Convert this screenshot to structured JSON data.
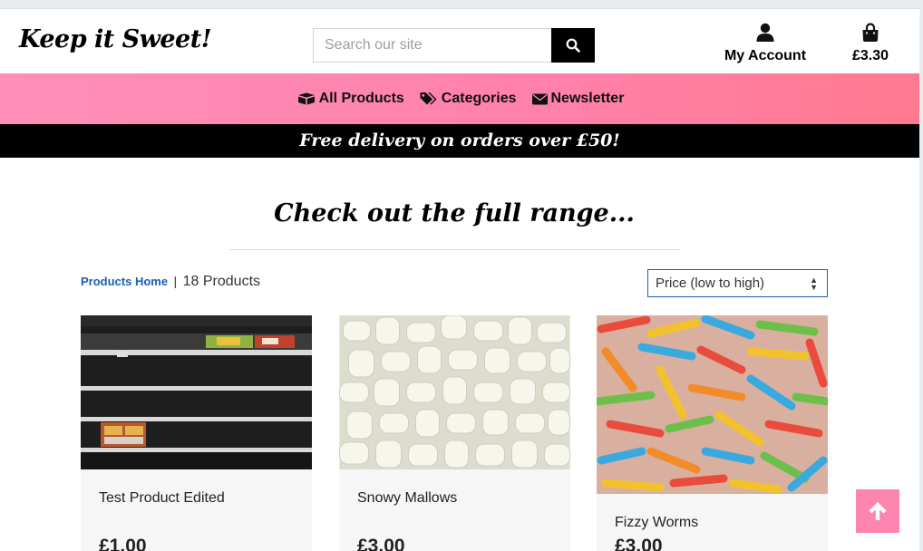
{
  "brand": {
    "logo": "Keep it Sweet!"
  },
  "search": {
    "placeholder": "Search our site",
    "value": ""
  },
  "header": {
    "account_label": "My Account",
    "bag_total": "£3.30"
  },
  "nav": {
    "items": [
      {
        "label": "All Products",
        "icon": "boxes-icon"
      },
      {
        "label": "Categories",
        "icon": "tags-icon"
      },
      {
        "label": "Newsletter",
        "icon": "envelope-icon"
      }
    ]
  },
  "promo": {
    "text": "Free delivery on orders over £50!"
  },
  "page": {
    "title": "Check out the full range..."
  },
  "breadcrumb": {
    "home_label": "Products Home",
    "separator": "|",
    "count": "18 Products"
  },
  "sort": {
    "selected": "Price (low to high)"
  },
  "products": [
    {
      "name": "Test Product Edited",
      "price": "£1.00",
      "image": "empty-shelves-photo"
    },
    {
      "name": "Snowy Mallows",
      "price": "£3.00",
      "image": "marshmallows-photo"
    },
    {
      "name": "Fizzy Worms",
      "price": "£3.00",
      "image": "fizzy-worms-photo"
    }
  ],
  "colors": {
    "accent_pink": "#ff80ab",
    "link_blue": "#1a5fb4",
    "promo_bg": "#000000"
  }
}
